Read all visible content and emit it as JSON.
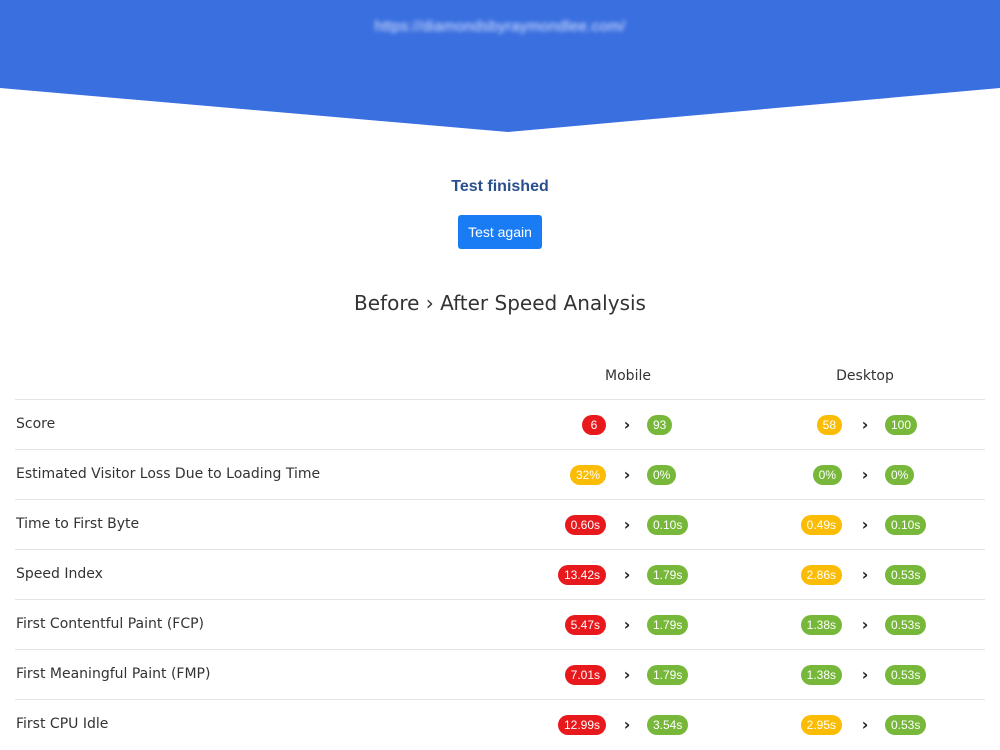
{
  "header": {
    "url": "https://diamondsbyraymondlee.com/",
    "bg_color": "#3a6fe0"
  },
  "status": {
    "text": "Test finished",
    "button_label": "Test again"
  },
  "heading": "Before › After Speed Analysis",
  "columns": {
    "mobile": "Mobile",
    "desktop": "Desktop"
  },
  "arrow_glyph": "›",
  "colors": {
    "red": "#e8191c",
    "yellow": "#fbbc05",
    "green": "#77b83a"
  },
  "rows": [
    {
      "label": "Score",
      "mobile_before": "6",
      "mobile_before_color": "red",
      "mobile_after": "93",
      "mobile_after_color": "green",
      "desktop_before": "58",
      "desktop_before_color": "yellow",
      "desktop_after": "100",
      "desktop_after_color": "green"
    },
    {
      "label": "Estimated Visitor Loss Due to Loading Time",
      "mobile_before": "32%",
      "mobile_before_color": "yellow",
      "mobile_after": "0%",
      "mobile_after_color": "green",
      "desktop_before": "0%",
      "desktop_before_color": "green",
      "desktop_after": "0%",
      "desktop_after_color": "green"
    },
    {
      "label": "Time to First Byte",
      "mobile_before": "0.60s",
      "mobile_before_color": "red",
      "mobile_after": "0.10s",
      "mobile_after_color": "green",
      "desktop_before": "0.49s",
      "desktop_before_color": "yellow",
      "desktop_after": "0.10s",
      "desktop_after_color": "green"
    },
    {
      "label": "Speed Index",
      "mobile_before": "13.42s",
      "mobile_before_color": "red",
      "mobile_after": "1.79s",
      "mobile_after_color": "green",
      "desktop_before": "2.86s",
      "desktop_before_color": "yellow",
      "desktop_after": "0.53s",
      "desktop_after_color": "green"
    },
    {
      "label": "First Contentful Paint (FCP)",
      "mobile_before": "5.47s",
      "mobile_before_color": "red",
      "mobile_after": "1.79s",
      "mobile_after_color": "green",
      "desktop_before": "1.38s",
      "desktop_before_color": "green",
      "desktop_after": "0.53s",
      "desktop_after_color": "green"
    },
    {
      "label": "First Meaningful Paint (FMP)",
      "mobile_before": "7.01s",
      "mobile_before_color": "red",
      "mobile_after": "1.79s",
      "mobile_after_color": "green",
      "desktop_before": "1.38s",
      "desktop_before_color": "green",
      "desktop_after": "0.53s",
      "desktop_after_color": "green"
    },
    {
      "label": "First CPU Idle",
      "mobile_before": "12.99s",
      "mobile_before_color": "red",
      "mobile_after": "3.54s",
      "mobile_after_color": "green",
      "desktop_before": "2.95s",
      "desktop_before_color": "yellow",
      "desktop_after": "0.53s",
      "desktop_after_color": "green"
    }
  ]
}
